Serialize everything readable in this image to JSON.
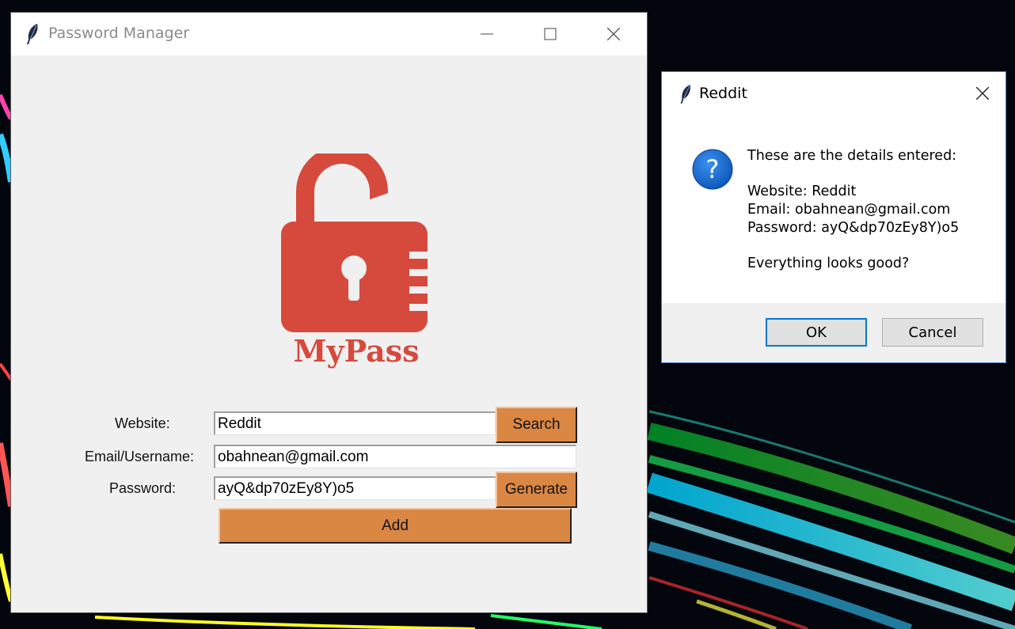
{
  "main_window": {
    "title": "Password Manager",
    "logo_text": "MyPass",
    "form": {
      "website_label": "Website:",
      "website_value": "Reddit",
      "email_label": "Email/Username:",
      "email_value": "obahnean@gmail.com",
      "password_label": "Password:",
      "password_value": "ayQ&dp70zEy8Y)o5",
      "search_label": "Search",
      "generate_label": "Generate",
      "add_label": "Add"
    }
  },
  "dialog": {
    "title": "Reddit",
    "icon": "question-icon",
    "message_heading": "These are the details entered:",
    "message_website": "Website: Reddit",
    "message_email": "Email: obahnean@gmail.com",
    "message_password": "Password: ayQ&dp70zEy8Y)o5",
    "message_question": "Everything looks good?",
    "ok_label": "OK",
    "cancel_label": "Cancel"
  },
  "colors": {
    "accent_orange": "#db8744",
    "logo_red": "#d64a3d",
    "dialog_default_border": "#0078d7",
    "question_icon_blue": "#1a6fd0"
  }
}
